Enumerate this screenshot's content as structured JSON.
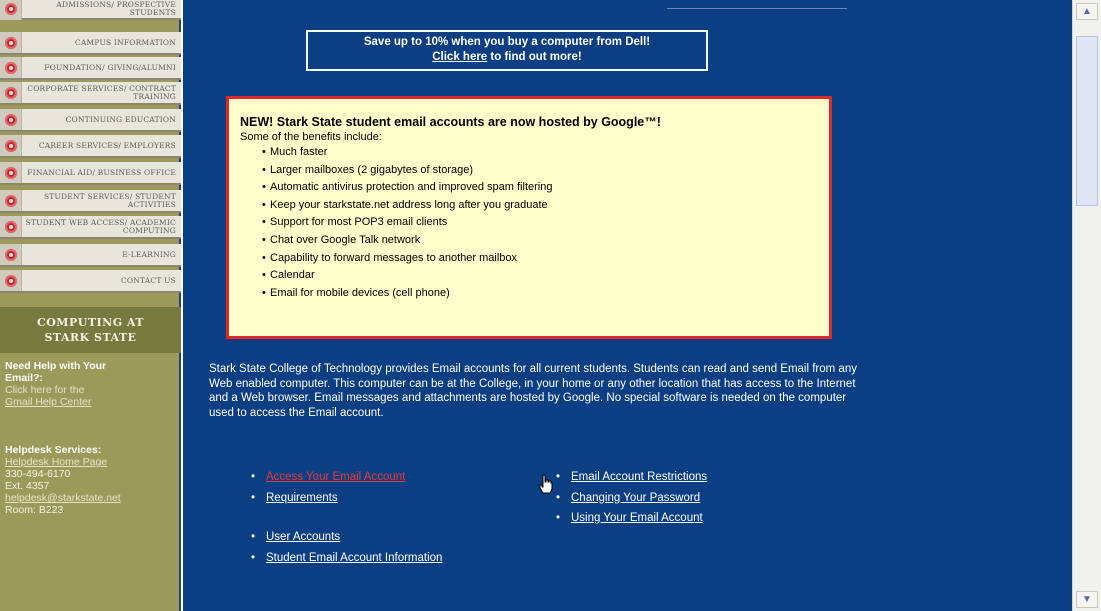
{
  "sidebar": {
    "items": [
      {
        "label": "ADMISSIONS/ PROSPECTIVE STUDENTS"
      },
      {
        "label": "CAMPUS INFORMATION"
      },
      {
        "label": "FOUNDATION/ GIVING/ALUMNI"
      },
      {
        "label": "CORPORATE SERVICES/ CONTRACT TRAINING"
      },
      {
        "label": "CONTINUING EDUCATION"
      },
      {
        "label": "CAREER SERVICES/ EMPLOYERS"
      },
      {
        "label": "FINANCIAL AID/ BUSINESS OFFICE"
      },
      {
        "label": "STUDENT SERVICES/ STUDENT ACTIVITIES"
      },
      {
        "label": "STUDENT WEB ACCESS/ ACADEMIC COMPUTING"
      },
      {
        "label": "E-LEARNING"
      },
      {
        "label": "CONTACT US"
      }
    ],
    "section_title_line1": "COMPUTING AT",
    "section_title_line2": "STARK STATE",
    "help_heading": "Need Help with Your Email?:",
    "help_text": "Click here for the",
    "help_link": "Gmail Help Center",
    "helpdesk_heading": "Helpdesk Services:",
    "helpdesk_link": "Helpdesk Home Page",
    "phone": "330-494-6170",
    "ext": "Ext. 4357",
    "email": "helpdesk@starkstate.net",
    "room": "Room: B223"
  },
  "promo": {
    "line1": "Save up to 10% when you buy a computer from Dell!",
    "link": "Click here",
    "line2_rest": " to find out more!"
  },
  "google_box": {
    "title": "NEW! Stark State student email accounts are now hosted by Google™!",
    "subtitle": "Some of the benefits include:",
    "benefits": [
      "Much faster",
      "Larger mailboxes (2 gigabytes of storage)",
      "Automatic antivirus protection and improved spam filtering",
      "Keep your starkstate.net address long after you graduate",
      "Support for most POP3 email clients",
      "Chat over Google Talk network",
      "Capability to forward messages to another mailbox",
      "Calendar",
      "Email for mobile devices (cell phone)"
    ]
  },
  "description": "Stark State College of Technology provides Email accounts for all current students. Students can read and send Email from any Web enabled computer. This computer can be at the College, in your home or any other location that has access to the Internet and a Web browser. Email messages and attachments are hosted by Google. No special software is needed on the computer used to access the Email account.",
  "links_left_a": [
    "Access Your Email Account",
    "Requirements"
  ],
  "links_left_b": [
    "User Accounts",
    "Student Email Account Information"
  ],
  "links_right": [
    "Email Account Restrictions",
    "Changing Your Password",
    "Using Your Email Account"
  ],
  "colors": {
    "main_bg": "#0b3e82",
    "sidebar_bg": "#9c9a5a",
    "highlight_box_bg": "#ffffcc",
    "highlight_box_border": "#e02a2a",
    "active_link": "#e83a3a"
  }
}
